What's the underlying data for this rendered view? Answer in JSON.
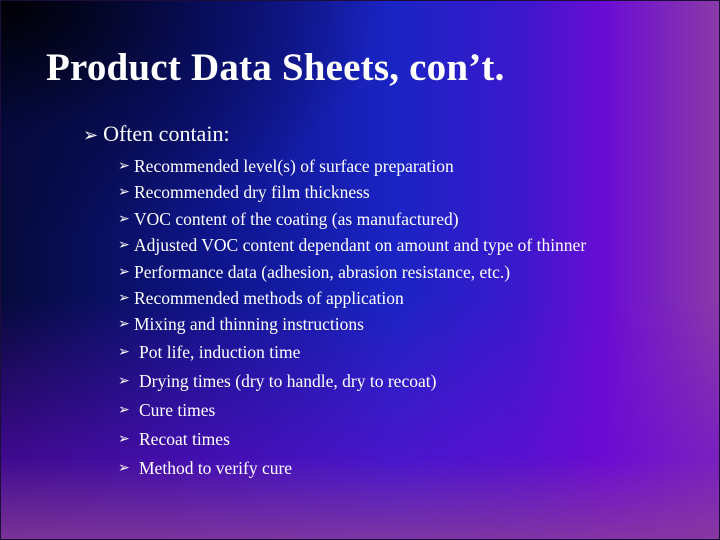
{
  "slide": {
    "title": "Product Data Sheets, con’t.",
    "bullet_glyph": "➢",
    "level1": {
      "text": "Often contain:"
    },
    "items": [
      {
        "text": "Recommended level(s) of surface preparation"
      },
      {
        "text": "Recommended dry film thickness"
      },
      {
        "text": "VOC content of the coating (as manufactured)"
      },
      {
        "text": "Adjusted VOC content dependant on amount and type of thinner"
      },
      {
        "text": "Performance data (adhesion, abrasion resistance, etc.)"
      },
      {
        "text": "Recommended methods of application"
      },
      {
        "text": "Mixing and thinning instructions"
      },
      {
        "text": "Pot life, induction time"
      },
      {
        "text": "Drying times (dry to handle, dry to recoat)"
      },
      {
        "text": "Cure times"
      },
      {
        "text": "Recoat times"
      },
      {
        "text": "Method to verify cure"
      }
    ]
  }
}
